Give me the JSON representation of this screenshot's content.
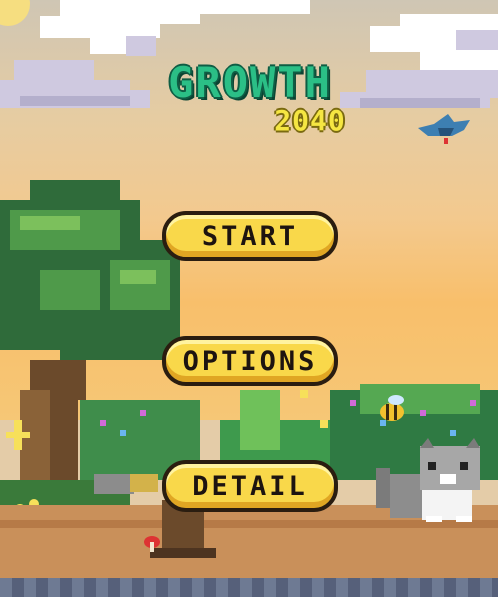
{
  "title": {
    "main": "GROWTH",
    "year": "2040"
  },
  "menu": {
    "start_label": "START",
    "options_label": "OPTIONS",
    "detail_label": "DETAIL"
  },
  "colors": {
    "title_main": "#2bbf86",
    "title_year": "#f5e642",
    "button_fill": "#f9d84a",
    "button_outline": "#2a1d10"
  }
}
